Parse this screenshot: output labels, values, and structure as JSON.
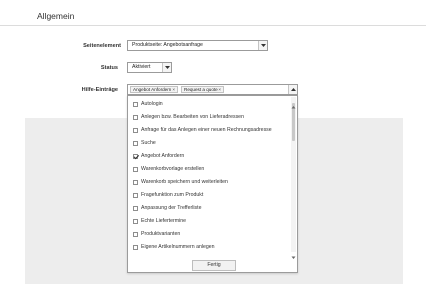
{
  "section": {
    "title": "Allgemein"
  },
  "fields": {
    "page_element": {
      "label": "Seitenelement",
      "value": "Produktseite: Angebotsanfrage"
    },
    "status": {
      "label": "Status",
      "value": "Aktiviert"
    },
    "help_entries": {
      "label": "Hilfe-Einträge",
      "tags": [
        "Angebot Anfordern",
        "Request a quote"
      ]
    }
  },
  "dropdown": {
    "options": [
      {
        "label": "Autologin",
        "checked": false
      },
      {
        "label": "Anlegen bzw. Bearbeiten von Lieferadressen",
        "checked": false
      },
      {
        "label": "Anfrage für das Anlegen einer neuen Rechnungsadresse",
        "checked": false
      },
      {
        "label": "Suche",
        "checked": false
      },
      {
        "label": "Angebot Anfordern",
        "checked": true
      },
      {
        "label": "Warenkorbvorlage erstellen",
        "checked": false
      },
      {
        "label": "Warenkorb speichern und weiterleiten",
        "checked": false
      },
      {
        "label": "Fragefunktion zum Produkt",
        "checked": false
      },
      {
        "label": "Anpassung der Trefferliste",
        "checked": false
      },
      {
        "label": "Echte Liefertermine",
        "checked": false
      },
      {
        "label": "Produktvarianten",
        "checked": false
      },
      {
        "label": "Eigene Artikelnummern anlegen",
        "checked": false
      }
    ],
    "done_label": "Fertig"
  }
}
